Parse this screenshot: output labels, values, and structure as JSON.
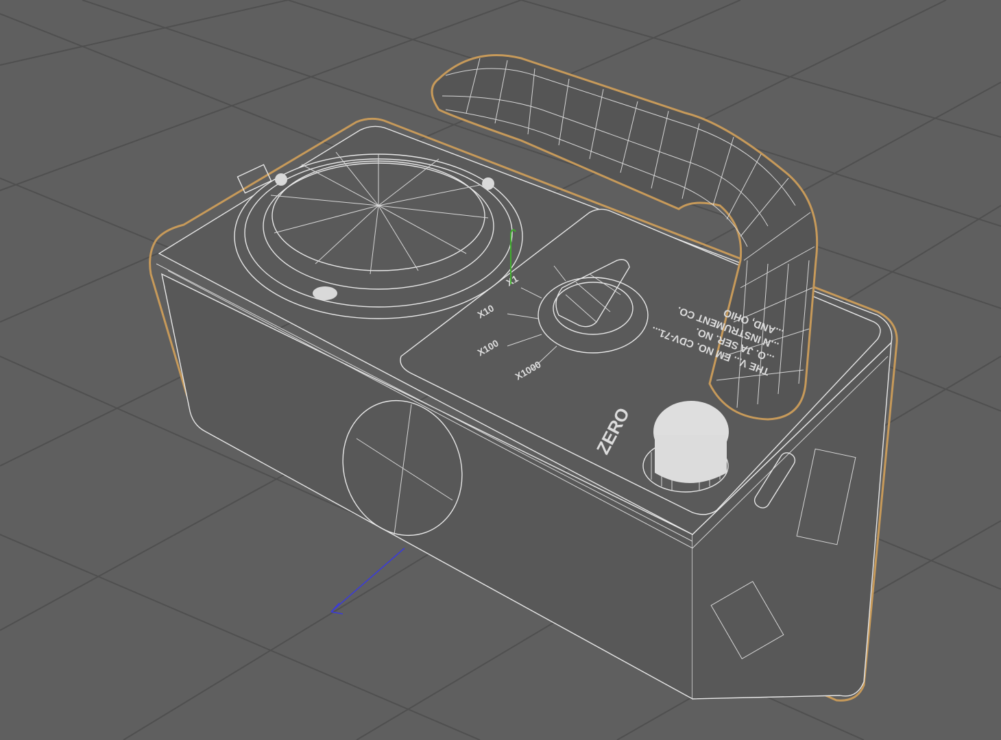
{
  "viewport": {
    "background_color": "#5f5f5f",
    "grid_color": "#4f4f4f",
    "wireframe_color": "#e8e8e8",
    "selection_outline_color": "#c79a5a",
    "axis_x_color": "#3a3adc",
    "axis_y_color": "#3fae2c"
  },
  "model": {
    "panel_texts": {
      "zero_label": "ZERO",
      "plate_line_1": "THE V... EM NO. CDV-71...",
      "plate_line_2": "...O. JA SER. NO.",
      "plate_line_3": "...N INSTRUMENT CO.",
      "plate_line_4": "...AND, OHIO"
    },
    "range_labels": [
      "X1",
      "X10",
      "X100",
      "X1000"
    ]
  }
}
